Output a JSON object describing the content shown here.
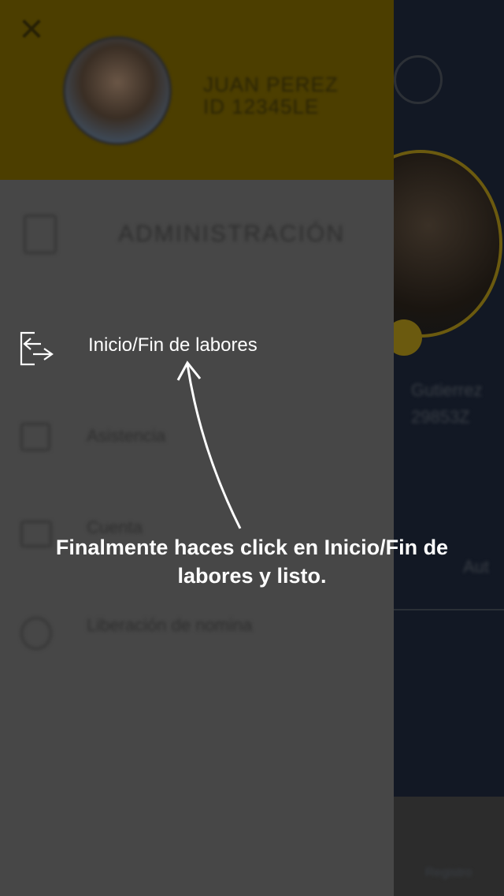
{
  "drawer": {
    "close_icon": "close-icon",
    "user": {
      "first_line": "JUAN PEREZ",
      "second_line": "ID 12345LE"
    },
    "section_title": "ADMINISTRACIÓN",
    "items": [
      {
        "icon": "logout-icon",
        "label": "Inicio/Fin de labores",
        "highlighted": true
      },
      {
        "icon": "edit-icon",
        "label": "Asistencia"
      },
      {
        "icon": "calendar-icon",
        "label": "Cuenta"
      },
      {
        "icon": "phone-icon",
        "label": "Liberación de nomina"
      }
    ]
  },
  "background": {
    "profile_line_1": "Gutierrez",
    "profile_line_2": "29853Z",
    "stat_label": "Aut",
    "bottom_label": "Registro"
  },
  "tutorial": {
    "instruction": "Finalmente haces click en Inicio/Fin de labores y listo."
  },
  "colors": {
    "drawer_header": "#4c3e00",
    "drawer_body": "#474747",
    "accent": "#f5c400",
    "overlay_text": "#ffffff"
  }
}
